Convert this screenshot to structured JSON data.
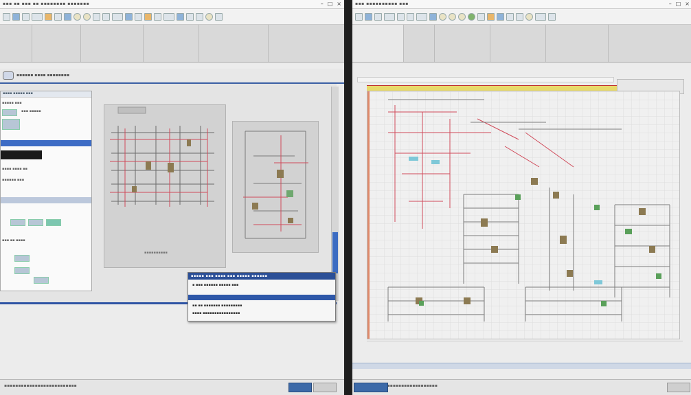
{
  "left_window": {
    "title": "▪▪▪  ▪▪ ▪▪▪ ▪▪ ▪▪▪▪▪▪▪▪ ▪▪▪▪▪▪▪",
    "controls": {
      "minimize": "–",
      "maximize": "□",
      "close": "×"
    },
    "tab_label": "▪▪▪▪▪▪ ▪▪▪▪ ▪▪▪▪▪▪▪▪",
    "side_panel": {
      "header": "▪▪▪▪ ▪▪▪▪▪ ▪▪▪",
      "rows": [
        "▪▪▪▪▪ ▪▪▪",
        "▪▪▪ ▪▪▪▪▪",
        "▪▪▪▪ ▪▪▪▪ ▪▪",
        "▪▪▪▪▪▪ ▪▪▪",
        "▪▪▪ ▪▪ ▪▪▪▪"
      ]
    },
    "page_caption": "▪▪▪▪▪▪▪▪▪▪",
    "dialog": {
      "title": "▪▪▪▪▪ ▪▪▪ ▪▪▪▪ ▪▪▪ ▪▪▪▪▪ ▪▪▪▪▪▪",
      "row1": "▪ ▪▪▪   ▪▪▪▪▪▪   ▪▪▪▪▪   ▪▪▪",
      "row2": "▪▪ ▪▪   ▪▪▪▪▪▪▪   ▪▪▪▪▪▪▪▪▪",
      "row3": "▪▪▪▪ ▪▪▪▪▪▪▪▪▪▪▪▪▪▪▪▪"
    },
    "status_text": "▪▪▪▪▪▪▪▪▪▪▪▪▪▪▪▪▪▪▪▪▪▪▪▪▪▪"
  },
  "right_window": {
    "title": "▪▪▪ ▪▪▪▪▪▪▪▪▪▪ ▪▪▪",
    "controls": {
      "minimize": "–",
      "maximize": "□",
      "close": "×"
    },
    "status_text": "▪▪▪▪▪▪▪▪▪▪▪▪▪▪▪▪▪▪▪▪▪▪▪▪▪▪▪▪▪"
  },
  "colors": {
    "accent_blue": "#2e53a3",
    "wire_red": "#d04a5a",
    "wire_gray": "#707070",
    "component_green": "#5aa05a",
    "canvas_header": "#e8d96a"
  }
}
